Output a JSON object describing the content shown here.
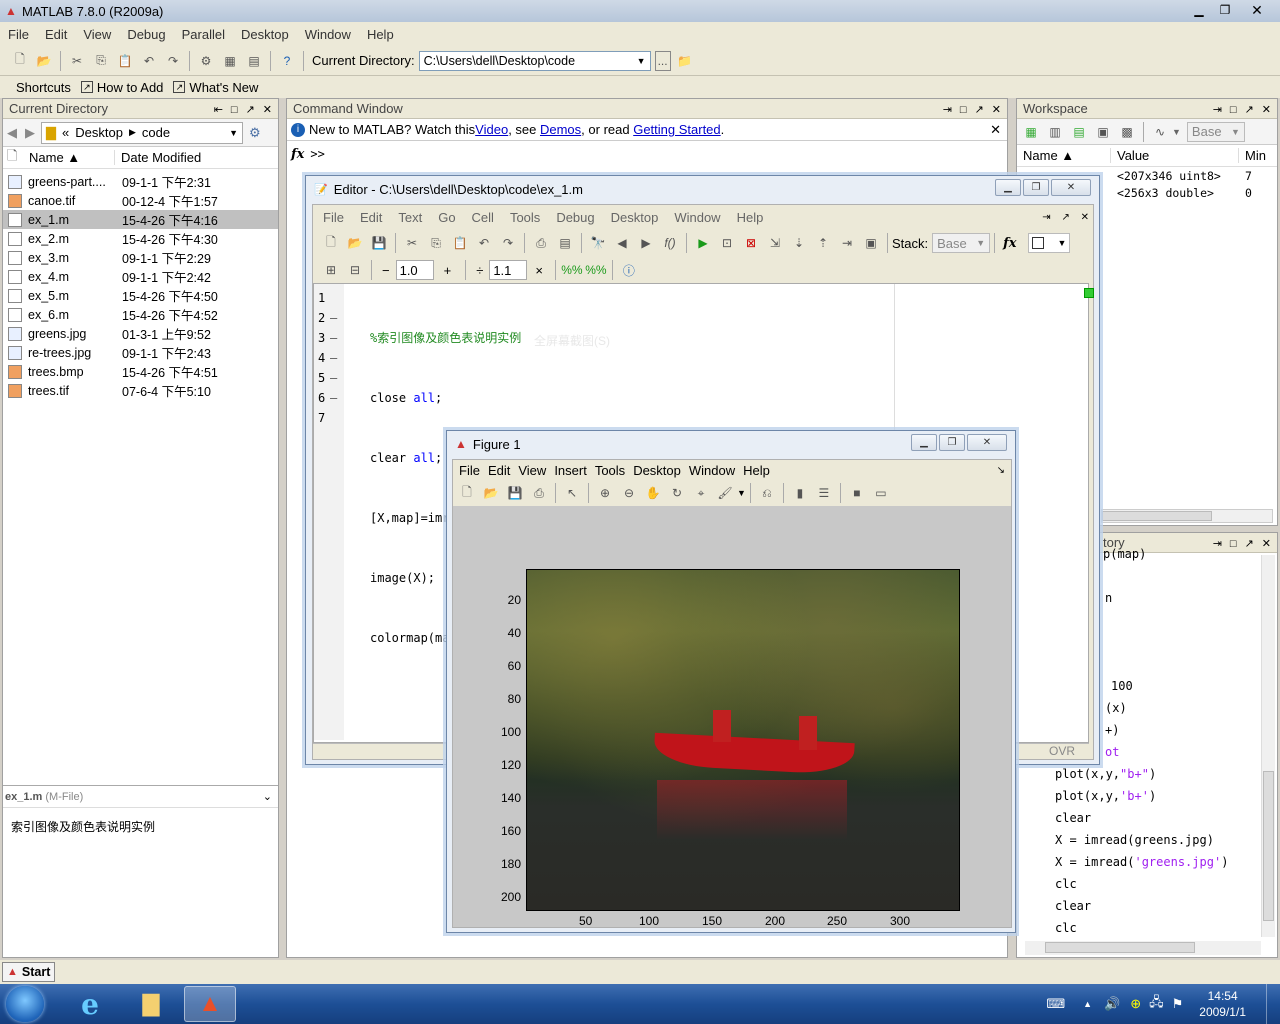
{
  "app": {
    "title": "MATLAB  7.8.0 (R2009a)"
  },
  "menu": [
    "File",
    "Edit",
    "View",
    "Debug",
    "Parallel",
    "Desktop",
    "Window",
    "Help"
  ],
  "toolbar": {
    "current_dir_label": "Current Directory:",
    "current_dir_value": "C:\\Users\\dell\\Desktop\\code",
    "browse": "..."
  },
  "shortcuts": {
    "label": "Shortcuts",
    "how_to_add": "How to Add",
    "whats_new": "What's New"
  },
  "current_directory": {
    "title": "Current Directory",
    "path": [
      "«",
      "Desktop",
      "code"
    ],
    "col_name": "Name ▲",
    "col_date": "Date Modified",
    "files": [
      {
        "name": "greens-part....",
        "date": "09-1-1 下午2:31"
      },
      {
        "name": "canoe.tif",
        "date": "00-12-4 下午1:57"
      },
      {
        "name": "ex_1.m",
        "date": "15-4-26 下午4:16"
      },
      {
        "name": "ex_2.m",
        "date": "15-4-26 下午4:30"
      },
      {
        "name": "ex_3.m",
        "date": "09-1-1 下午2:29"
      },
      {
        "name": "ex_4.m",
        "date": "09-1-1 下午2:42"
      },
      {
        "name": "ex_5.m",
        "date": "15-4-26 下午4:50"
      },
      {
        "name": "ex_6.m",
        "date": "15-4-26 下午4:52"
      },
      {
        "name": "greens.jpg",
        "date": "01-3-1 上午9:52"
      },
      {
        "name": "re-trees.jpg",
        "date": "09-1-1 下午2:43"
      },
      {
        "name": "trees.bmp",
        "date": "15-4-26 下午4:51"
      },
      {
        "name": "trees.tif",
        "date": "07-6-4 下午5:10"
      }
    ],
    "detail_title": "ex_1.m",
    "detail_type": "(M-File)",
    "detail_desc": "索引图像及颜色表说明实例"
  },
  "command_window": {
    "title": "Command Window",
    "info_prefix": "New to MATLAB? Watch this ",
    "link_video": "Video",
    "mid1": ", see ",
    "link_demos": "Demos",
    "mid2": ", or read ",
    "link_getting_started": "Getting Started",
    "end": ".",
    "prompt": ">>",
    "fx": "fx"
  },
  "workspace": {
    "title": "Workspace",
    "base": "Base",
    "cols": [
      "Name ▲",
      "Value",
      "Min"
    ],
    "rows": [
      {
        "value": "<207x346 uint8>",
        "min": "7"
      },
      {
        "value": "<256x3 double>",
        "min": "0"
      }
    ]
  },
  "history": {
    "title": "tory",
    "partial": [
      "p(map)",
      "n",
      "100",
      "(x)",
      "+)",
      "ot"
    ],
    "lines": [
      "plot(x,y,\"b+\")",
      "plot(x,y,'b+')",
      "clear",
      "X = imread(greens.jpg)",
      "X = imread('greens.jpg')",
      "clc",
      "clear",
      "clc"
    ]
  },
  "editor": {
    "title": "Editor - C:\\Users\\dell\\Desktop\\code\\ex_1.m",
    "menu": [
      "File",
      "Edit",
      "Text",
      "Go",
      "Cell",
      "Tools",
      "Debug",
      "Desktop",
      "Window",
      "Help"
    ],
    "stack_label": "Stack:",
    "stack_value": "Base",
    "cell_minus": "−",
    "cell_val1": "1.0",
    "cell_plus": "+",
    "cell_div": "÷",
    "cell_val2": "1.1",
    "cell_x": "×",
    "status": "OVR",
    "lines": [
      "1",
      "2",
      "3",
      "4",
      "5",
      "6",
      "7"
    ],
    "ghost": "全屏幕截图(S)"
  },
  "figure": {
    "title": "Figure 1",
    "menu": [
      "File",
      "Edit",
      "View",
      "Insert",
      "Tools",
      "Desktop",
      "Window",
      "Help"
    ],
    "yticks": [
      "20",
      "40",
      "60",
      "80",
      "100",
      "120",
      "140",
      "160",
      "180",
      "200"
    ],
    "xticks": [
      "50",
      "100",
      "150",
      "200",
      "250",
      "300"
    ]
  },
  "taskbar": {
    "start": "Start",
    "time": "14:54",
    "date": "2009/1/1"
  }
}
